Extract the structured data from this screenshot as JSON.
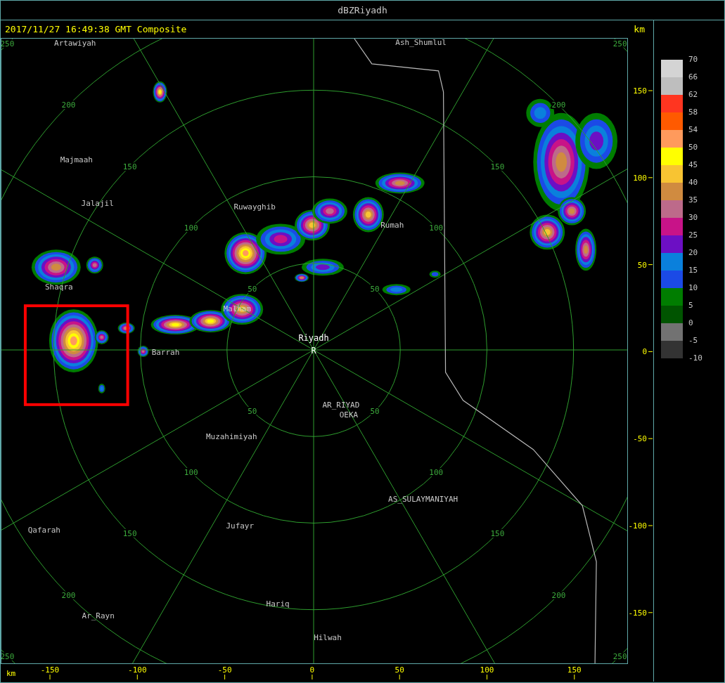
{
  "window": {
    "title": "dBZRiyadh"
  },
  "header": {
    "timestamp": "2017/11/27 16:49:38 GMT Composite",
    "unit": "km"
  },
  "plot": {
    "radar_site": {
      "name": "Riyadh",
      "marker": "R"
    },
    "places": [
      "Artawiyah",
      "Ash_Shumlul",
      "Majmaah",
      "Jalajil",
      "Ruwayghib",
      "Rumah",
      "Shaqra",
      "Malham",
      "Barrah",
      "AR_RIYAD",
      "OEKA",
      "Muzahimiyah",
      "AS_SULAYMANIYAH",
      "Qafarah",
      "Jufayr",
      "Hariq",
      "Ar_Rayn",
      "Hilwah"
    ],
    "range_rings": [
      {
        "labels": [
          "50",
          "50",
          "50",
          "50"
        ]
      },
      {
        "labels": [
          "100",
          "100",
          "100",
          "100"
        ]
      },
      {
        "labels": [
          "150",
          "150",
          "150",
          "150"
        ]
      },
      {
        "labels": [
          "200",
          "200",
          "200",
          "200"
        ]
      },
      {
        "labels": [
          "250",
          "250",
          "250",
          "250"
        ]
      }
    ]
  },
  "x_axis": {
    "unit": "km",
    "ticks": [
      "-150",
      "-100",
      "-50",
      "0",
      "50",
      "100",
      "150"
    ]
  },
  "y_axis": {
    "ticks": [
      "150",
      "100",
      "50",
      "0",
      "-50",
      "-100",
      "-150"
    ]
  },
  "legend": {
    "labels": [
      "70",
      "66",
      "62",
      "58",
      "54",
      "50",
      "45",
      "40",
      "35",
      "30",
      "25",
      "20",
      "15",
      "10",
      "5",
      "0",
      "-5",
      "-10"
    ],
    "bins": [
      {
        "color": "#d4d4d4"
      },
      {
        "color": "#bebebe"
      },
      {
        "color": "#ff3520"
      },
      {
        "color": "#ff5a00"
      },
      {
        "color": "#ff9a5c"
      },
      {
        "color": "#ffff00"
      },
      {
        "color": "#f8c432"
      },
      {
        "color": "#d08b40"
      },
      {
        "color": "#bd6a8a"
      },
      {
        "color": "#c81388"
      },
      {
        "color": "#6c0fc4"
      },
      {
        "color": "#0a80dc"
      },
      {
        "color": "#1b4ae6"
      },
      {
        "color": "#007d00"
      },
      {
        "color": "#005400"
      },
      {
        "color": "#727272"
      },
      {
        "color": "#333333"
      }
    ]
  }
}
